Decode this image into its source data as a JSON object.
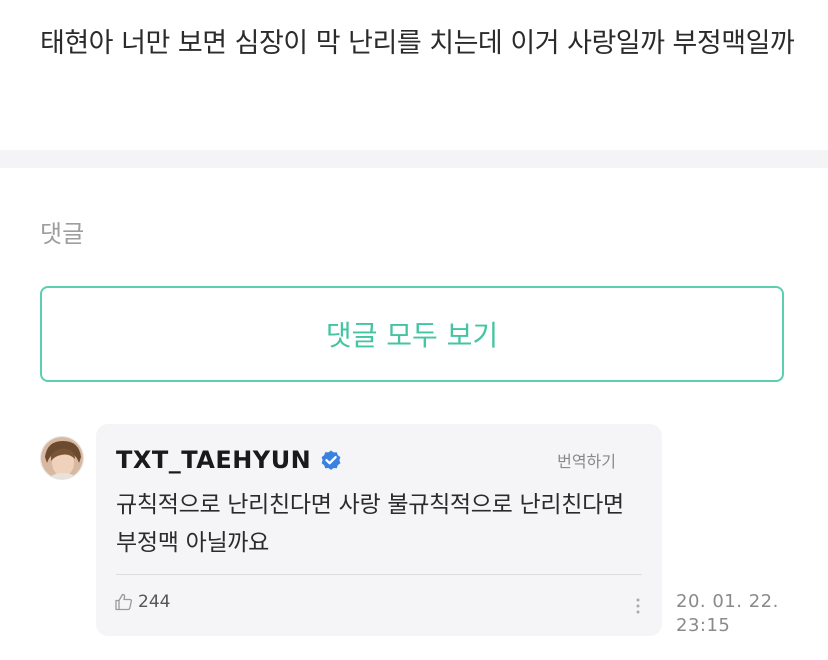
{
  "post": {
    "text": "태현아 너만 보면 심장이 막 난리를 치는데 이거 사랑일까 부정맥일까"
  },
  "comments_section": {
    "heading": "댓글",
    "view_all_label": "댓글 모두 보기"
  },
  "comment": {
    "author": "TXT_TAEHYUN",
    "verified_icon": "verified-badge-icon",
    "translate_label": "번역하기",
    "body": "규칙적으로 난리친다면 사랑 불규칙적으로 난리친다면 부정맥 아닐까요",
    "likes": "244",
    "like_icon": "thumbs-up-icon",
    "more_icon": "vertical-ellipsis-icon",
    "date": "20. 01. 22.",
    "time": "23:15"
  },
  "colors": {
    "accent": "#44c4a1",
    "accent_border": "#5ccfb0",
    "verified": "#3b82e0",
    "card_bg": "#f5f5f7"
  }
}
